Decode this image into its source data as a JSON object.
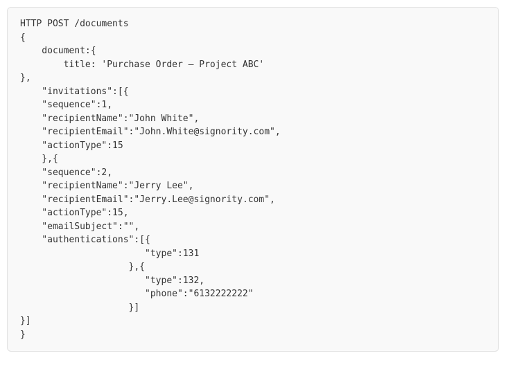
{
  "code": {
    "lines": [
      "HTTP POST /documents",
      "{",
      "    document:{",
      "        title: 'Purchase Order – Project ABC'",
      "},",
      "    \"invitations\":[{",
      "    \"sequence\":1,",
      "    \"recipientName\":\"John White\",",
      "    \"recipientEmail\":\"John.White@signority.com\",",
      "    \"actionType\":15",
      "    },{",
      "    \"sequence\":2,",
      "    \"recipientName\":\"Jerry Lee\",",
      "    \"recipientEmail\":\"Jerry.Lee@signority.com\",",
      "    \"actionType\":15,",
      "    \"emailSubject\":\"\",",
      "    \"authentications\":[{",
      "                       \"type\":131",
      "                    },{",
      "                       \"type\":132,",
      "                       \"phone\":\"6132222222\"",
      "                    }]",
      "}]",
      "}"
    ]
  }
}
